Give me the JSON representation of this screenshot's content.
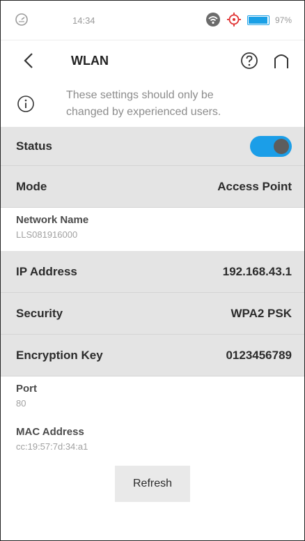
{
  "status_bar": {
    "time": "14:34",
    "battery_pct": "97%"
  },
  "header": {
    "title": "WLAN"
  },
  "info": {
    "line1": "These settings should only be",
    "line2": "changed by experienced users."
  },
  "rows": {
    "status": {
      "label": "Status",
      "enabled": true
    },
    "mode": {
      "label": "Mode",
      "value": "Access Point"
    },
    "ip": {
      "label": "IP Address",
      "value": "192.168.43.1"
    },
    "security": {
      "label": "Security",
      "value": "WPA2 PSK"
    },
    "key": {
      "label": "Encryption Key",
      "value": "0123456789"
    }
  },
  "fields": {
    "network_name": {
      "label": "Network Name",
      "value": "LLS081916000"
    },
    "port": {
      "label": "Port",
      "value": "80"
    },
    "mac": {
      "label": "MAC Address",
      "value": "cc:19:57:7d:34:a1"
    }
  },
  "actions": {
    "refresh_label": "Refresh"
  },
  "colors": {
    "accent": "#1b9ee8",
    "row_gray": "#e4e4e4",
    "muted_text": "#8c8c8c"
  },
  "icons": {
    "left": [
      "speedometer-icon"
    ],
    "right": [
      "wifi-icon",
      "location-target-icon",
      "battery-icon"
    ],
    "header": [
      "back-chevron-icon",
      "help-icon",
      "home-icon"
    ],
    "info": "info-icon"
  }
}
